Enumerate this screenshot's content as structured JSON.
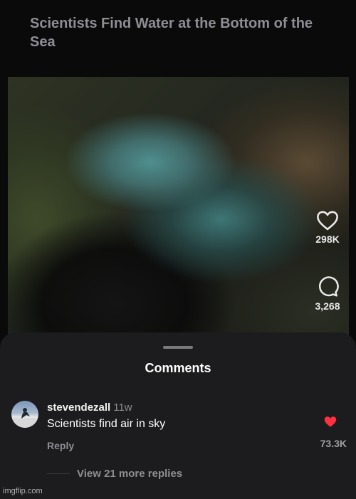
{
  "post": {
    "caption": "Scientists Find Water at the Bottom of the Sea"
  },
  "actions": {
    "likes": "298K",
    "comments": "3,268"
  },
  "comments_sheet": {
    "title": "Comments",
    "comment": {
      "username": "stevendezall",
      "time": "11w",
      "text": "Scientists find air in sky",
      "reply_label": "Reply",
      "like_count": "73.3K",
      "liked": true,
      "view_replies": "View 21 more replies"
    }
  },
  "colors": {
    "like_red": "#ff3040",
    "sheet_bg": "#1c1c1e",
    "muted_text": "#8e8e93"
  },
  "watermark": "imgflip.com"
}
